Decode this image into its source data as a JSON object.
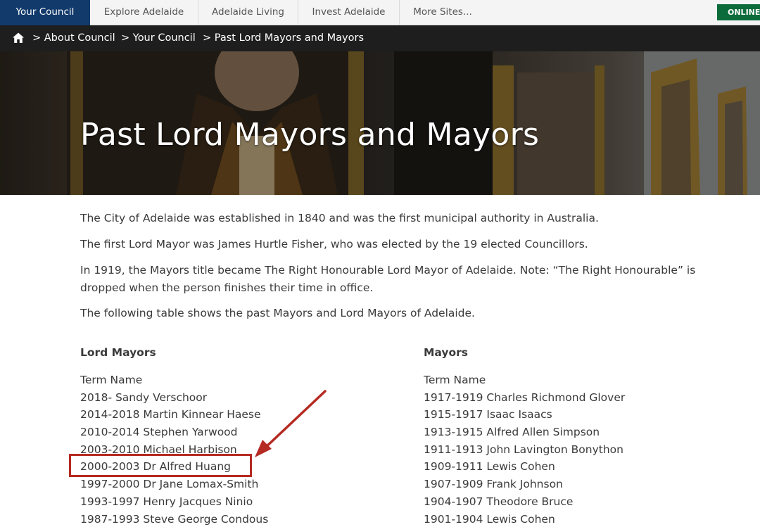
{
  "topnav": {
    "tabs": [
      {
        "label": "Your Council"
      },
      {
        "label": "Explore Adelaide"
      },
      {
        "label": "Adelaide Living"
      },
      {
        "label": "Invest Adelaide"
      },
      {
        "label": "More Sites..."
      }
    ],
    "online_label": "ONLINE"
  },
  "breadcrumb": {
    "home_icon": "home-icon",
    "items": [
      {
        "label": "> About Council"
      },
      {
        "label": "> Your Council"
      },
      {
        "label": "> Past Lord Mayors and Mayors"
      }
    ]
  },
  "hero": {
    "title": "Past Lord Mayors and Mayors"
  },
  "intro": {
    "p1": "The City of Adelaide was established in 1840 and was the first municipal authority in Australia.",
    "p2": "The first Lord Mayor was James Hurtle Fisher, who was elected by the 19 elected Councillors.",
    "p3": "In 1919, the Mayors title became The Right Honourable Lord Mayor of Adelaide. Note: “The Right Honourable” is dropped when the person finishes their time in office.",
    "p4": "The following table shows the past Mayors and Lord Mayors of Adelaide."
  },
  "lord_mayors": {
    "heading": "Lord Mayors",
    "header_row": "Term Name",
    "rows": [
      "2018- Sandy Verschoor",
      "2014-2018 Martin Kinnear Haese",
      "2010-2014 Stephen Yarwood",
      "2003-2010 Michael Harbison",
      "2000-2003 Dr Alfred Huang",
      "1997-2000 Dr Jane Lomax-Smith",
      "1993-1997 Henry Jacques Ninio",
      "1987-1993 Steve George Condous"
    ]
  },
  "mayors": {
    "heading": "Mayors",
    "header_row": "Term Name",
    "rows": [
      "1917-1919 Charles Richmond Glover",
      "1915-1917 Isaac Isaacs",
      "1913-1915 Alfred Allen Simpson",
      "1911-1913 John Lavington Bonython",
      "1909-1911 Lewis Cohen",
      "1907-1909 Frank Johnson",
      "1904-1907 Theodore Bruce",
      "1901-1904 Lewis Cohen"
    ]
  },
  "annotation": {
    "color": "#b52a22"
  }
}
